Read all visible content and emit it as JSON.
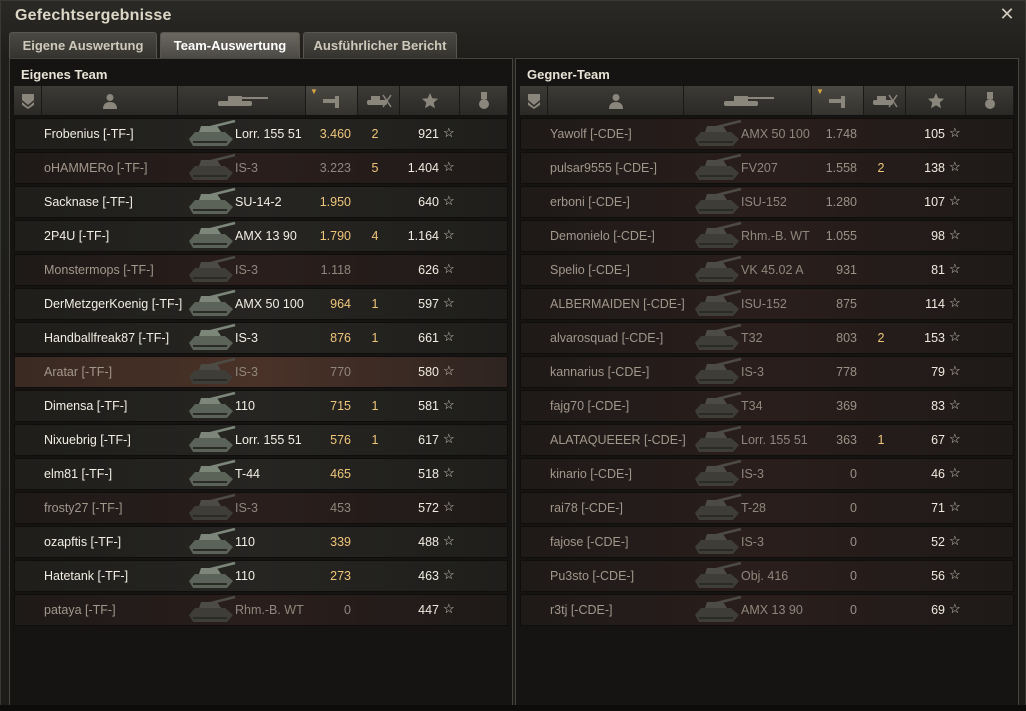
{
  "window": {
    "title": "Gefechtsergebnisse"
  },
  "tabs": [
    {
      "label": "Eigene Auswertung",
      "active": false
    },
    {
      "label": "Team-Auswertung",
      "active": true
    },
    {
      "label": "Ausführlicher Bericht",
      "active": false
    }
  ],
  "icons": {
    "close": "close-icon",
    "columns": [
      "rank-icon",
      "player-icon",
      "tank-icon",
      "xp-icon",
      "kills-icon",
      "star-icon",
      "medal-icon"
    ],
    "row_star": "☆"
  },
  "colors": {
    "xp_gold": "#f0c67a",
    "dead_row": "#2a1e1c",
    "alive_row": "#262522"
  },
  "left": {
    "title": "Eigenes Team",
    "rows": [
      {
        "name": "Frobenius [-TF-]",
        "tank": "Lorr. 155 51",
        "xp": "3.460",
        "kills": "2",
        "damage": "921",
        "status": "alive"
      },
      {
        "name": "oHAMMERo [-TF-]",
        "tank": "IS-3",
        "xp": "3.223",
        "kills": "5",
        "damage": "1.404",
        "status": "dead"
      },
      {
        "name": "Sacknase [-TF-]",
        "tank": "SU-14-2",
        "xp": "1.950",
        "kills": "",
        "damage": "640",
        "status": "alive"
      },
      {
        "name": "2P4U [-TF-]",
        "tank": "AMX 13 90",
        "xp": "1.790",
        "kills": "4",
        "damage": "1.164",
        "status": "alive"
      },
      {
        "name": "Monstermops [-TF-]",
        "tank": "IS-3",
        "xp": "1.118",
        "kills": "",
        "damage": "626",
        "status": "dead"
      },
      {
        "name": "DerMetzgerKoenig [-TF-]",
        "tank": "AMX 50 100",
        "xp": "964",
        "kills": "1",
        "damage": "597",
        "status": "alive"
      },
      {
        "name": "Handballfreak87 [-TF-]",
        "tank": "IS-3",
        "xp": "876",
        "kills": "1",
        "damage": "661",
        "status": "alive"
      },
      {
        "name": "Aratar [-TF-]",
        "tank": "IS-3",
        "xp": "770",
        "kills": "",
        "damage": "580",
        "status": "highlight"
      },
      {
        "name": "Dimensa [-TF-]",
        "tank": "110",
        "xp": "715",
        "kills": "1",
        "damage": "581",
        "status": "alive"
      },
      {
        "name": "Nixuebrig [-TF-]",
        "tank": "Lorr. 155 51",
        "xp": "576",
        "kills": "1",
        "damage": "617",
        "status": "alive"
      },
      {
        "name": "elm81 [-TF-]",
        "tank": "T-44",
        "xp": "465",
        "kills": "",
        "damage": "518",
        "status": "alive"
      },
      {
        "name": "frosty27 [-TF-]",
        "tank": "IS-3",
        "xp": "453",
        "kills": "",
        "damage": "572",
        "status": "dead"
      },
      {
        "name": "ozapftis [-TF-]",
        "tank": "110",
        "xp": "339",
        "kills": "",
        "damage": "488",
        "status": "alive"
      },
      {
        "name": "Hatetank [-TF-]",
        "tank": "110",
        "xp": "273",
        "kills": "",
        "damage": "463",
        "status": "alive"
      },
      {
        "name": "pataya [-TF-]",
        "tank": "Rhm.-B. WT",
        "xp": "0",
        "kills": "",
        "damage": "447",
        "status": "dead"
      }
    ]
  },
  "right": {
    "title": "Gegner-Team",
    "rows": [
      {
        "name": "Yawolf [-CDE-]",
        "tank": "AMX 50 100",
        "xp": "1.748",
        "kills": "",
        "damage": "105",
        "status": "dead"
      },
      {
        "name": "pulsar9555 [-CDE-]",
        "tank": "FV207",
        "xp": "1.558",
        "kills": "2",
        "damage": "138",
        "status": "dead"
      },
      {
        "name": "erboni [-CDE-]",
        "tank": "ISU-152",
        "xp": "1.280",
        "kills": "",
        "damage": "107",
        "status": "dead"
      },
      {
        "name": "Demonielo [-CDE-]",
        "tank": "Rhm.-B. WT",
        "xp": "1.055",
        "kills": "",
        "damage": "98",
        "status": "dead"
      },
      {
        "name": "Spelio [-CDE-]",
        "tank": "VK 45.02 A",
        "xp": "931",
        "kills": "",
        "damage": "81",
        "status": "dead"
      },
      {
        "name": "ALBERMAIDEN [-CDE-]",
        "tank": "ISU-152",
        "xp": "875",
        "kills": "",
        "damage": "114",
        "status": "dead"
      },
      {
        "name": "alvarosquad [-CDE-]",
        "tank": "T32",
        "xp": "803",
        "kills": "2",
        "damage": "153",
        "status": "dead"
      },
      {
        "name": "kannarius [-CDE-]",
        "tank": "IS-3",
        "xp": "778",
        "kills": "",
        "damage": "79",
        "status": "dead"
      },
      {
        "name": "fajg70 [-CDE-]",
        "tank": "T34",
        "xp": "369",
        "kills": "",
        "damage": "83",
        "status": "dead"
      },
      {
        "name": "ALATAQUEEER [-CDE-]",
        "tank": "Lorr. 155 51",
        "xp": "363",
        "kills": "1",
        "damage": "67",
        "status": "dead"
      },
      {
        "name": "kinario [-CDE-]",
        "tank": "IS-3",
        "xp": "0",
        "kills": "",
        "damage": "46",
        "status": "dead"
      },
      {
        "name": "rai78 [-CDE-]",
        "tank": "T-28",
        "xp": "0",
        "kills": "",
        "damage": "71",
        "status": "dead"
      },
      {
        "name": "fajose [-CDE-]",
        "tank": "IS-3",
        "xp": "0",
        "kills": "",
        "damage": "52",
        "status": "dead"
      },
      {
        "name": "Pu3sto [-CDE-]",
        "tank": "Obj. 416",
        "xp": "0",
        "kills": "",
        "damage": "56",
        "status": "dead"
      },
      {
        "name": "r3tj [-CDE-]",
        "tank": "AMX 13 90",
        "xp": "0",
        "kills": "",
        "damage": "69",
        "status": "dead"
      }
    ]
  }
}
